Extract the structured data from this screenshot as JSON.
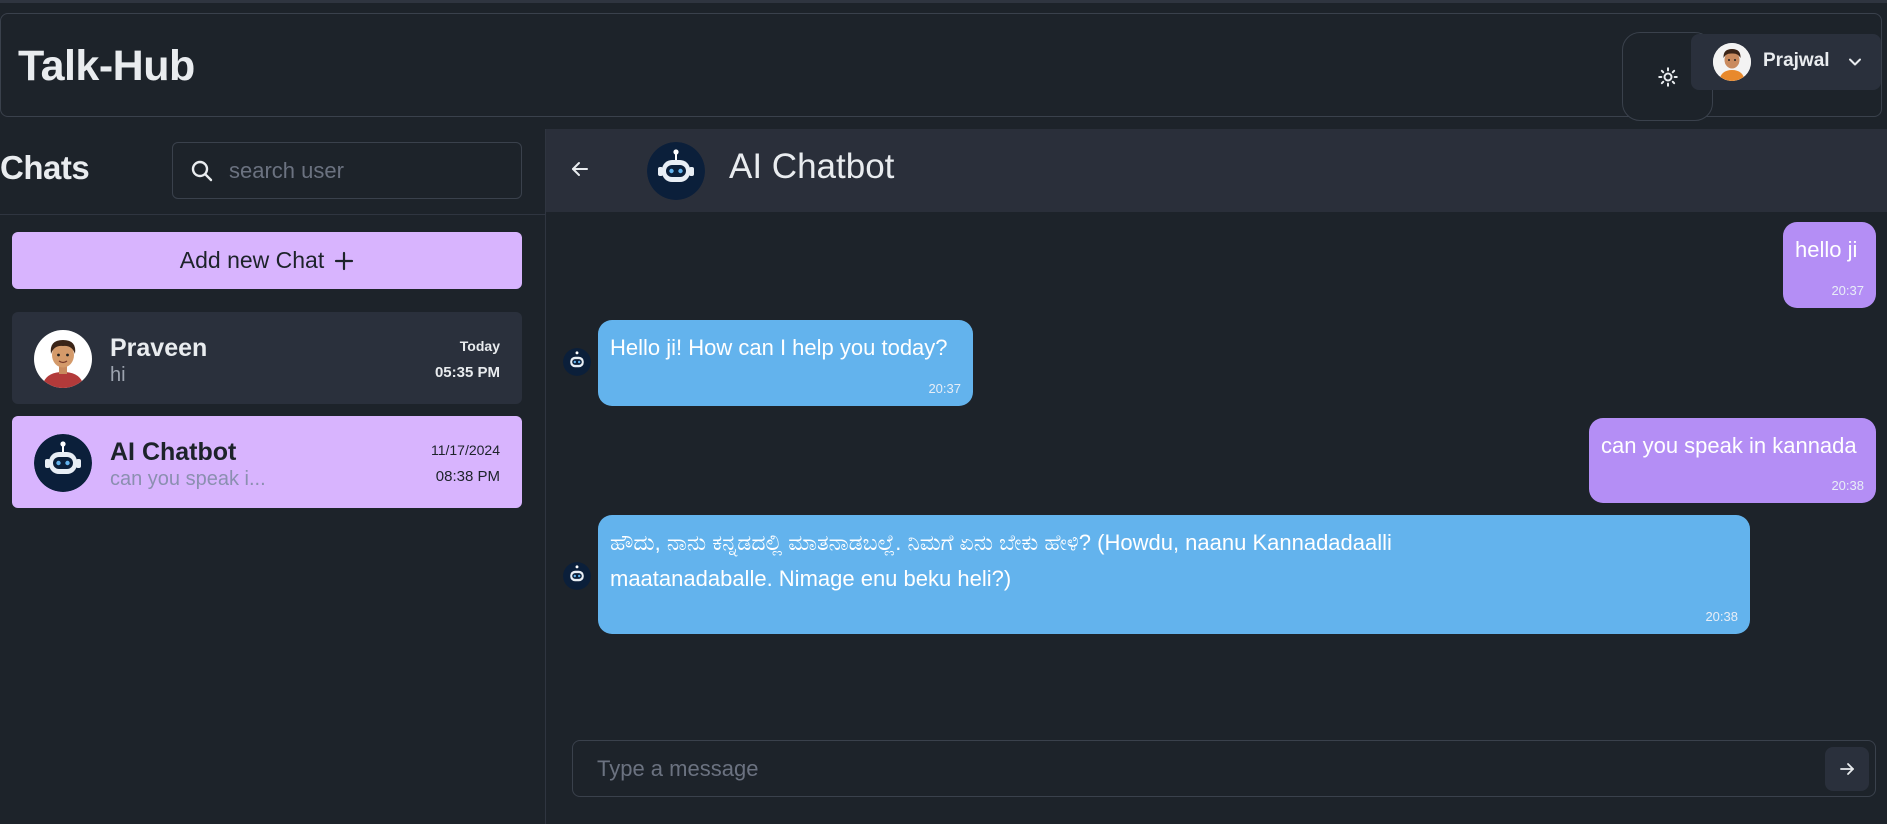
{
  "app": {
    "brand": "Talk-Hub",
    "user": {
      "name": "Prajwal",
      "avatar_icon": "user-avatar-icon"
    },
    "theme_icon": "sun-icon"
  },
  "sidebar": {
    "title": "Chats",
    "search": {
      "placeholder": "search user",
      "value": ""
    },
    "add_chat_label": "Add new Chat",
    "add_chat_icon": "+",
    "chats": [
      {
        "name": "Praveen",
        "preview": "hi",
        "date": "Today",
        "time": "05:35 PM",
        "selected": false
      },
      {
        "name": "AI Chatbot",
        "preview": "can you speak i...",
        "date": "11/17/2024",
        "time": "08:38 PM",
        "selected": true
      }
    ]
  },
  "conversation": {
    "title": "AI Chatbot",
    "messages": [
      {
        "direction": "out",
        "text": "hello ji",
        "time": "20:37"
      },
      {
        "direction": "in",
        "text": "Hello ji! How can I help you today?",
        "time": "20:37"
      },
      {
        "direction": "out",
        "text": "can you speak in kannada",
        "time": "20:38"
      },
      {
        "direction": "in",
        "text_line1": "ಹೌದು, ನಾನು ಕನ್ನಡದಲ್ಲಿ ಮಾತನಾಡಬಲ್ಲೆ. ನಿಮಗೆ ಏನು ಬೇಕು ಹೇಳಿ? (Howdu, naanu Kannadadaalli",
        "text_line2": "maatanadaballe. Nimage enu beku heli?)",
        "time": "20:38"
      }
    ],
    "input": {
      "placeholder": "Type a message",
      "value": ""
    }
  },
  "colors": {
    "background": "#1d232a",
    "panel": "#2a303c",
    "accent_purple": "#d8b4fe",
    "outgoing_bubble": "#b48ef5",
    "incoming_bubble": "#63b3ed"
  }
}
